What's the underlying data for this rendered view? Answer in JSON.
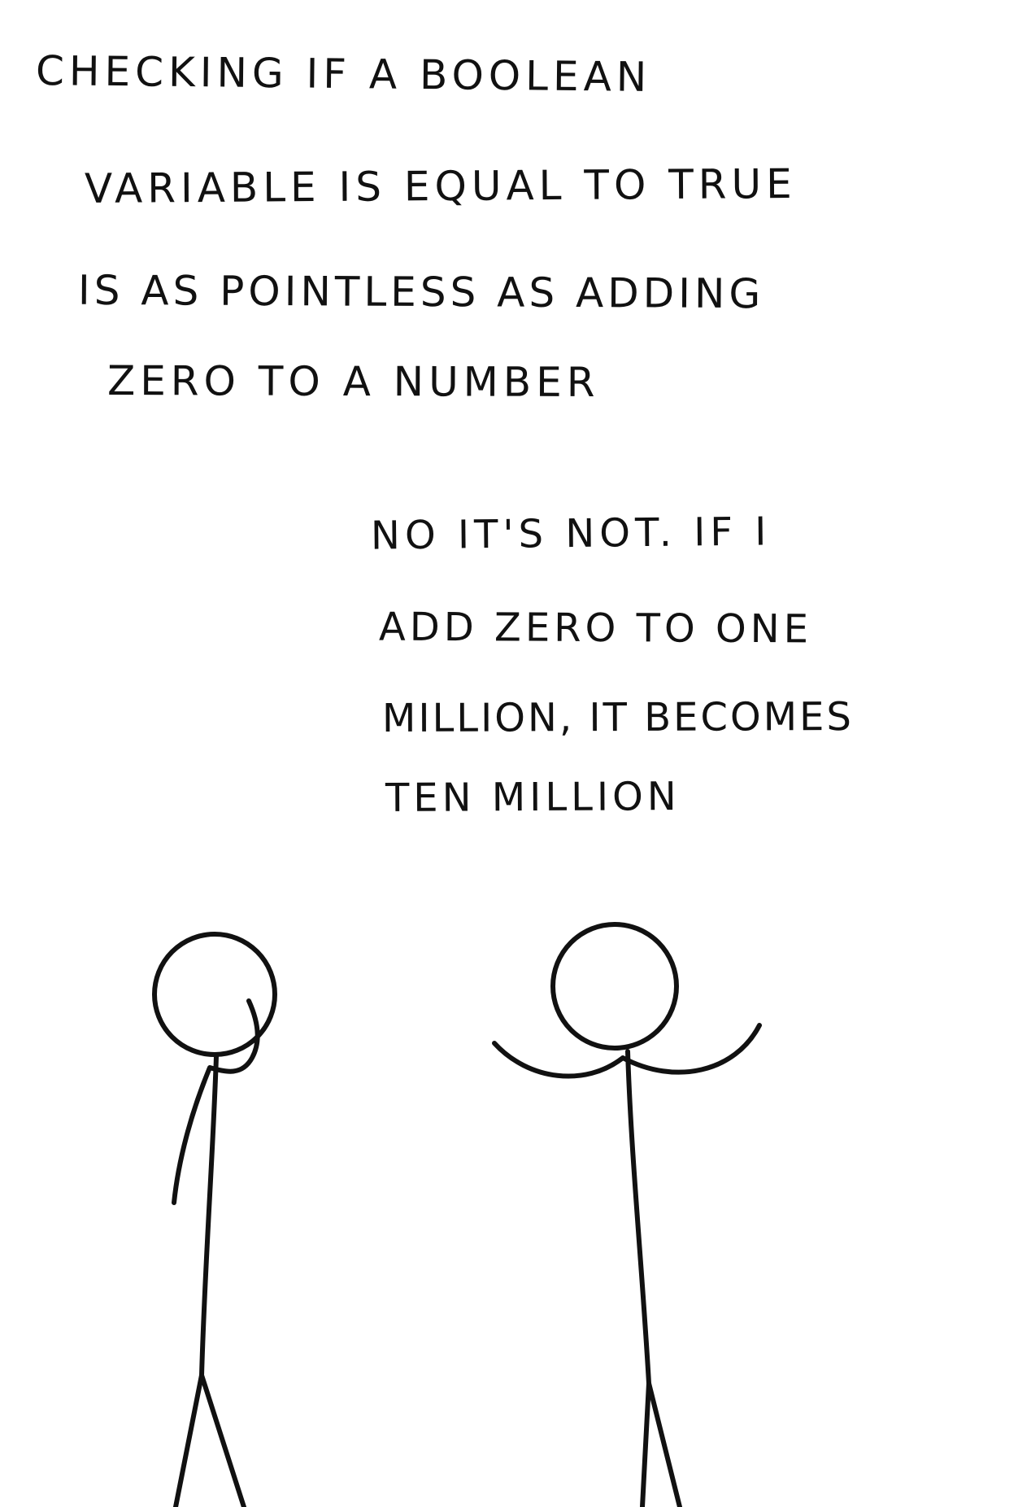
{
  "caption": {
    "lines": [
      "CHECKING IF A BOOLEAN",
      "VARIABLE IS EQUAL TO TRUE",
      "IS AS POINTLESS AS ADDING",
      "ZERO TO A NUMBER"
    ]
  },
  "reply": {
    "lines": [
      "NO IT'S NOT. IF I",
      "ADD ZERO TO ONE",
      "MILLION, IT BECOMES",
      "TEN MILLION"
    ]
  },
  "characters": {
    "left": "thinking stick figure",
    "right": "shrugging stick figure"
  },
  "colors": {
    "ink": "#111111",
    "background": "#ffffff"
  }
}
